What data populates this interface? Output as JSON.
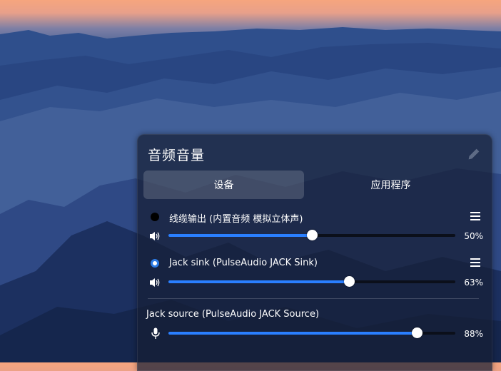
{
  "panel": {
    "title": "音频音量",
    "edit_icon": "pencil-icon"
  },
  "tabs": [
    {
      "label": "设备",
      "active": true
    },
    {
      "label": "应用程序",
      "active": false
    }
  ],
  "outputs": [
    {
      "name": "线缆输出 (内置音频 模拟立体声)",
      "selected": false,
      "volume_text": "50%",
      "volume": 0.5,
      "icon": "speaker-icon"
    },
    {
      "name": "Jack sink (PulseAudio JACK Sink)",
      "selected": true,
      "volume_text": "63%",
      "volume": 0.63,
      "icon": "speaker-icon"
    }
  ],
  "inputs": [
    {
      "name": "Jack source (PulseAudio JACK Source)",
      "volume_text": "88%",
      "volume": 0.88,
      "icon": "microphone-icon"
    }
  ],
  "colors": {
    "accent": "#2a7fff"
  }
}
